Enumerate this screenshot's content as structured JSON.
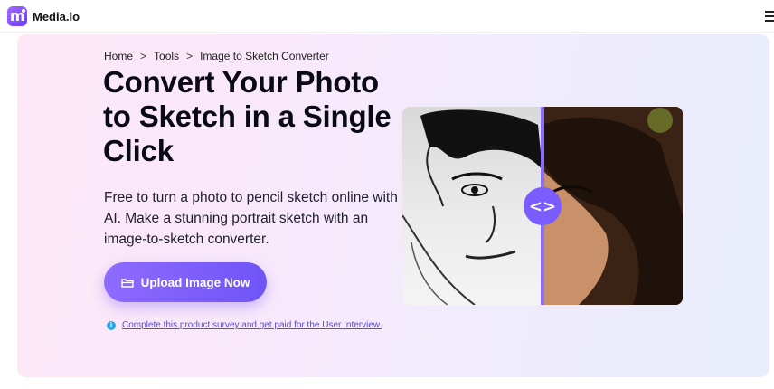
{
  "brand": {
    "name": "Media.io",
    "logo_letter": "m"
  },
  "nav": {
    "menu_icon": "hamburger-menu-icon"
  },
  "breadcrumb": {
    "items": [
      "Home",
      "Tools",
      "Image to Sketch Converter"
    ],
    "separator": ">"
  },
  "hero": {
    "title": "Convert Your Photo to Sketch in a Single Click",
    "description": "Free to turn a photo to pencil sketch online with AI. Make a stunning portrait sketch with an image-to-sketch converter.",
    "upload_button": "Upload Image Now",
    "upload_icon": "folder-icon",
    "survey_info_icon": "i",
    "survey_link": "Complete this product survey and get paid for the User Interview.",
    "compare_handle_label": "<>"
  },
  "colors": {
    "accent": "#7a5cff",
    "hero_bg_start": "#fde7f6",
    "hero_bg_end": "#e9edfc",
    "info_icon": "#2aa7e8"
  }
}
